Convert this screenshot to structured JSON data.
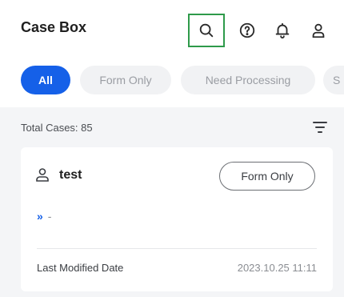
{
  "header": {
    "title": "Case Box"
  },
  "filters": [
    {
      "label": "All",
      "selected": true
    },
    {
      "label": "Form Only",
      "selected": false
    },
    {
      "label": "Need Processing",
      "selected": false
    },
    {
      "label": "S",
      "selected": false
    }
  ],
  "list": {
    "total_label": "Total Cases: 85"
  },
  "card": {
    "name": "test",
    "badge": "Form Only",
    "progress_chevron": "»",
    "progress_text": "-",
    "modified_label": "Last Modified Date",
    "modified_value": "2023.10.25 11:11"
  },
  "colors": {
    "accent": "#1560e8",
    "focus_outline": "#2e9a4a"
  },
  "icons": [
    "search-icon",
    "help-icon",
    "bell-icon",
    "user-icon",
    "filter-icon",
    "person-icon"
  ]
}
